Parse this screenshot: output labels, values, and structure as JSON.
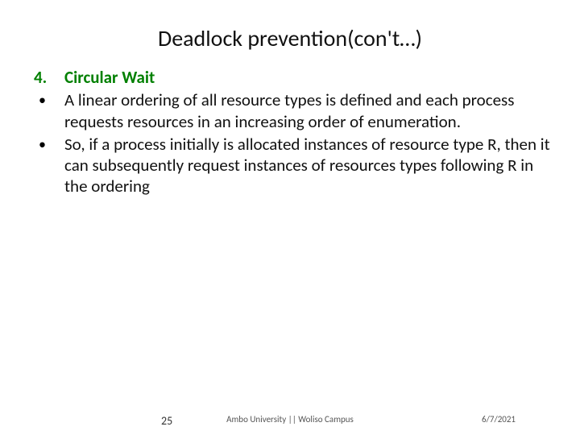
{
  "title": "Deadlock prevention(con't…)",
  "item_number": "4.",
  "heading": "Circular Wait",
  "bullets": [
    "A linear ordering of all resource types is defined and each process requests resources in an increasing order of enumeration.",
    "So, if a process initially is allocated instances of resource type R, then it can subsequently request instances of resources types following R in the ordering"
  ],
  "footer": {
    "page": "25",
    "center": "Ambo University || Woliso Campus",
    "date": "6/7/2021"
  }
}
